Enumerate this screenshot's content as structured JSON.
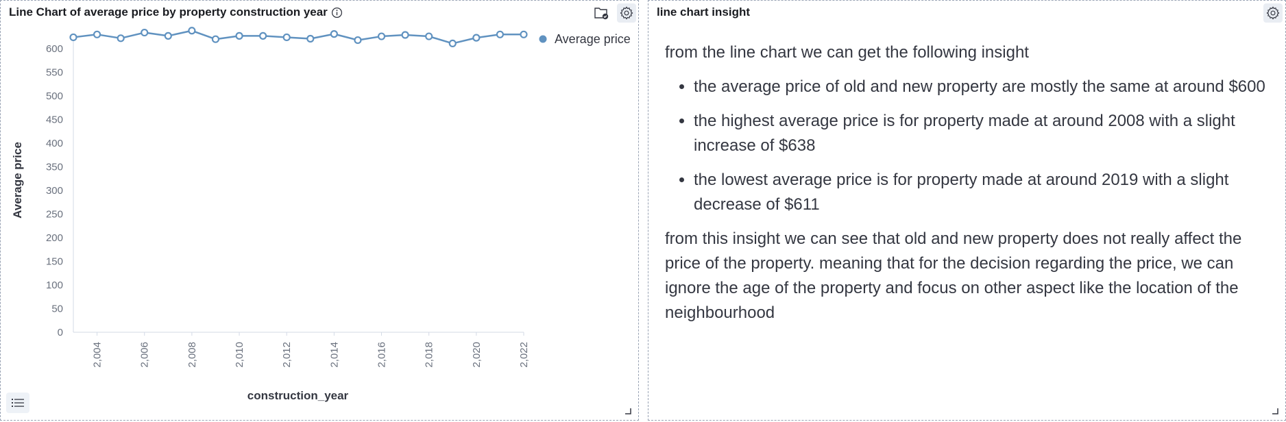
{
  "left_panel": {
    "title": "Line Chart of average price by property construction year"
  },
  "right_panel": {
    "title": "line chart insight",
    "intro": "from the line chart we can get the following insight",
    "bullets": [
      "the average price of old and new property are mostly the same at around $600",
      "the highest average price is for property made at around 2008 with a slight increase of $638",
      "the lowest average price is for property made at around 2019 with a slight decrease of $611"
    ],
    "conclusion": "from this insight we can see that old and new property does not really affect the price of the property. meaning that for the decision regarding the price, we can ignore the age of the property and focus on other aspect like the location of the neighbourhood"
  },
  "chart_data": {
    "type": "line",
    "xlabel": "construction_year",
    "ylabel": "Average price",
    "x": [
      2003,
      2004,
      2005,
      2006,
      2007,
      2008,
      2009,
      2010,
      2011,
      2012,
      2013,
      2014,
      2015,
      2016,
      2017,
      2018,
      2019,
      2020,
      2021,
      2022
    ],
    "x_tick_labels": [
      "2,004",
      "2,006",
      "2,008",
      "2,010",
      "2,012",
      "2,014",
      "2,016",
      "2,018",
      "2,020",
      "2,022"
    ],
    "x_ticks": [
      2004,
      2006,
      2008,
      2010,
      2012,
      2014,
      2016,
      2018,
      2020,
      2022
    ],
    "y_ticks": [
      0,
      50,
      100,
      150,
      200,
      250,
      300,
      350,
      400,
      450,
      500,
      550,
      600
    ],
    "ylim": [
      0,
      600
    ],
    "series": [
      {
        "name": "Average price",
        "color": "#6092c0",
        "values": [
          624,
          630,
          622,
          634,
          627,
          638,
          620,
          627,
          627,
          624,
          621,
          631,
          618,
          626,
          629,
          626,
          611,
          623,
          630,
          630
        ]
      }
    ],
    "legend_position": "top-right",
    "grid": false
  },
  "colors": {
    "series": "#6092c0",
    "border": "#98a2b3",
    "text": "#343741"
  }
}
